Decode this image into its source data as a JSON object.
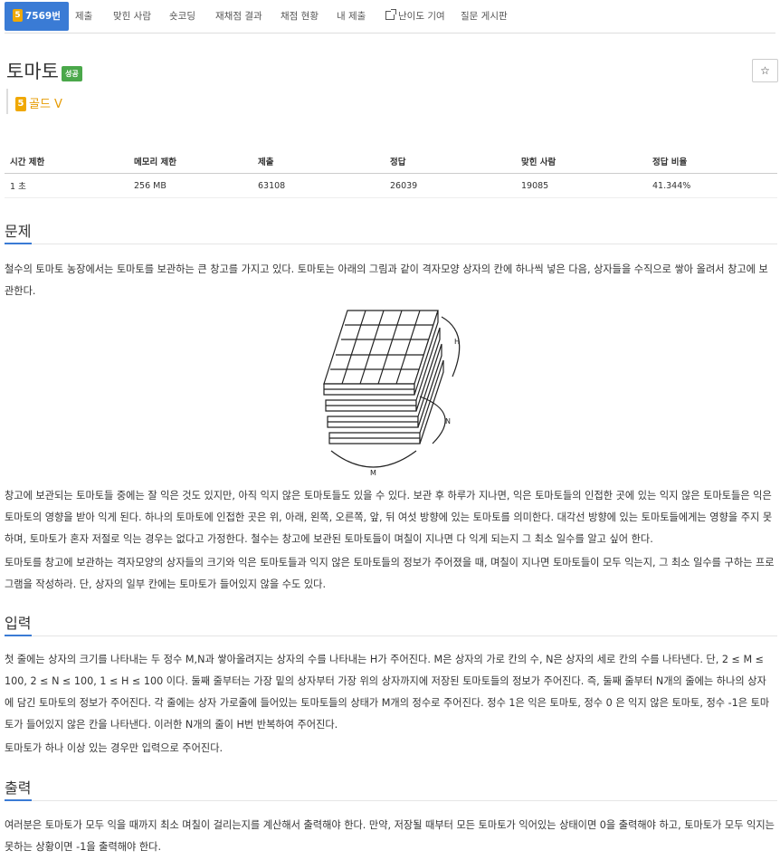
{
  "nav": {
    "problem_id_tab": "7569번",
    "tier_digit": "5",
    "tabs": [
      "제출",
      "맞힌 사람",
      "숏코딩",
      "재채점 결과",
      "채점 현황",
      "내 제출",
      "난이도 기여",
      "질문 게시판"
    ]
  },
  "problem": {
    "title": "토마토",
    "status_badge": "성공",
    "star": "☆",
    "tier": "골드 V",
    "tier_digit": "5"
  },
  "info_table": {
    "headers": [
      "시간 제한",
      "메모리 제한",
      "제출",
      "정답",
      "맞힌 사람",
      "정답 비율"
    ],
    "values": [
      "1 초",
      "256 MB",
      "63108",
      "26039",
      "19085",
      "41.344%"
    ]
  },
  "sections": {
    "problem_heading": "문제",
    "input_heading": "입력",
    "output_heading": "출력"
  },
  "figure_labels": {
    "h": "H",
    "n": "N",
    "m": "M"
  },
  "text": {
    "p1": "철수의 토마토 농장에서는 토마토를 보관하는 큰 창고를 가지고 있다. 토마토는 아래의 그림과 같이 격자모양 상자의 칸에 하나씩 넣은 다음, 상자들을 수직으로 쌓아 올려서 창고에 보관한다.",
    "p2": "창고에 보관되는 토마토들 중에는 잘 익은 것도 있지만, 아직 익지 않은 토마토들도 있을 수 있다. 보관 후 하루가 지나면, 익은 토마토들의 인접한 곳에 있는 익지 않은 토마토들은 익은 토마토의 영향을 받아 익게 된다. 하나의 토마토에 인접한 곳은 위, 아래, 왼쪽, 오른쪽, 앞, 뒤 여섯 방향에 있는 토마토를 의미한다. 대각선 방향에 있는 토마토들에게는 영향을 주지 못하며, 토마토가 혼자 저절로 익는 경우는 없다고 가정한다. 철수는 창고에 보관된 토마토들이 며칠이 지나면 다 익게 되는지 그 최소 일수를 알고 싶어 한다.",
    "p3": "토마토를 창고에 보관하는 격자모양의 상자들의 크기와 익은 토마토들과 익지 않은 토마토들의 정보가 주어졌을 때, 며칠이 지나면 토마토들이 모두 익는지, 그 최소 일수를 구하는 프로그램을 작성하라. 단, 상자의 일부 칸에는 토마토가 들어있지 않을 수도 있다.",
    "input1": "첫 줄에는 상자의 크기를 나타내는 두 정수 M,N과 쌓아올려지는 상자의 수를 나타내는 H가 주어진다. M은 상자의 가로 칸의 수, N은 상자의 세로 칸의 수를 나타낸다. 단, 2 ≤ M ≤ 100, 2 ≤ N ≤ 100, 1 ≤ H ≤ 100 이다. 둘째 줄부터는 가장 밑의 상자부터 가장 위의 상자까지에 저장된 토마토들의 정보가 주어진다. 즉, 둘째 줄부터 N개의 줄에는 하나의 상자에 담긴 토마토의 정보가 주어진다. 각 줄에는 상자 가로줄에 들어있는 토마토들의 상태가 M개의 정수로 주어진다. 정수 1은 익은 토마토, 정수 0 은 익지 않은 토마토, 정수 -1은 토마토가 들어있지 않은 칸을 나타낸다. 이러한 N개의 줄이 H번 반복하여 주어진다.",
    "input2": "토마토가 하나 이상 있는 경우만 입력으로 주어진다.",
    "output1": "여러분은 토마토가 모두 익을 때까지 최소 며칠이 걸리는지를 계산해서 출력해야 한다. 만약, 저장될 때부터 모든 토마토가 익어있는 상태이면 0을 출력해야 하고, 토마토가 모두 익지는 못하는 상황이면 -1을 출력해야 한다."
  }
}
